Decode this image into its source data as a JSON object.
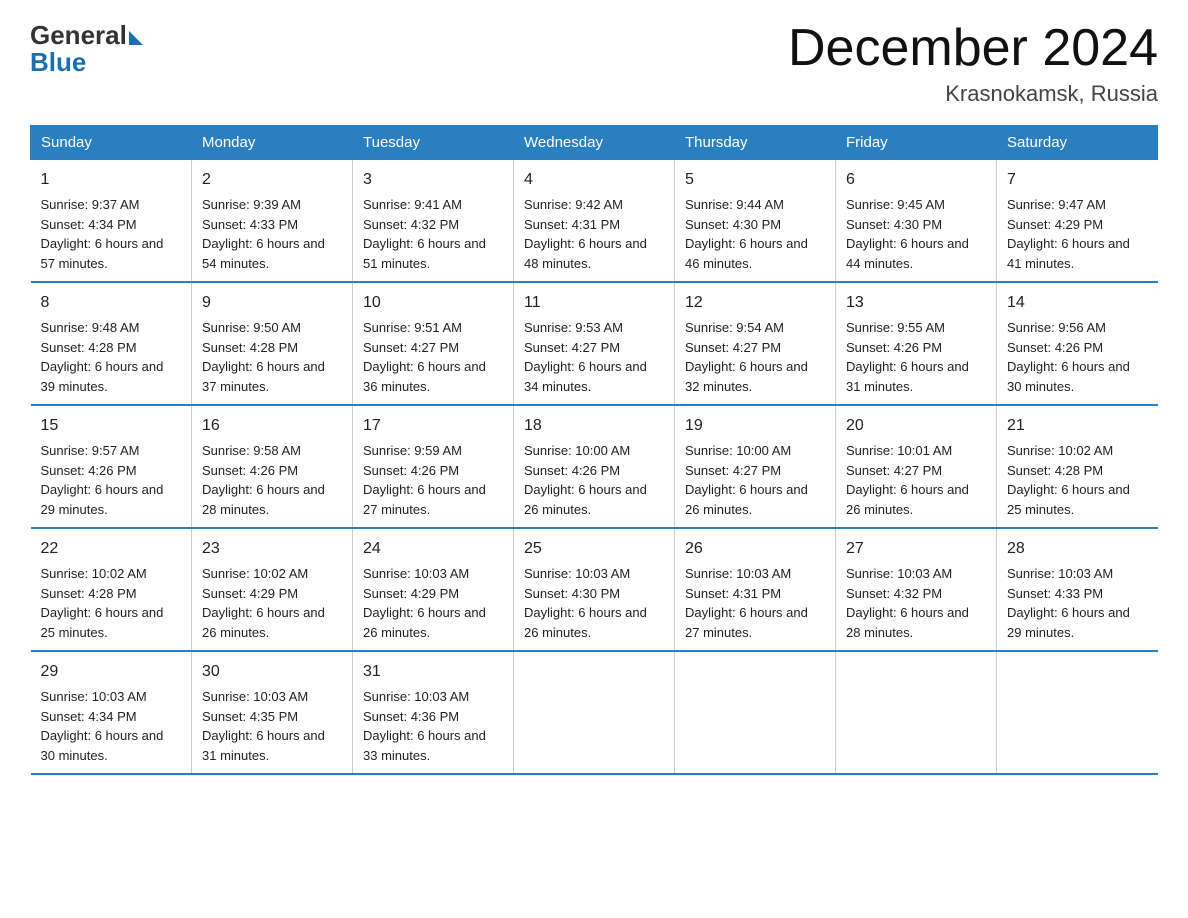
{
  "logo": {
    "general": "General",
    "blue": "Blue"
  },
  "title": "December 2024",
  "location": "Krasnokamsk, Russia",
  "weekdays": [
    "Sunday",
    "Monday",
    "Tuesday",
    "Wednesday",
    "Thursday",
    "Friday",
    "Saturday"
  ],
  "weeks": [
    [
      {
        "day": "1",
        "sunrise": "9:37 AM",
        "sunset": "4:34 PM",
        "daylight": "6 hours and 57 minutes."
      },
      {
        "day": "2",
        "sunrise": "9:39 AM",
        "sunset": "4:33 PM",
        "daylight": "6 hours and 54 minutes."
      },
      {
        "day": "3",
        "sunrise": "9:41 AM",
        "sunset": "4:32 PM",
        "daylight": "6 hours and 51 minutes."
      },
      {
        "day": "4",
        "sunrise": "9:42 AM",
        "sunset": "4:31 PM",
        "daylight": "6 hours and 48 minutes."
      },
      {
        "day": "5",
        "sunrise": "9:44 AM",
        "sunset": "4:30 PM",
        "daylight": "6 hours and 46 minutes."
      },
      {
        "day": "6",
        "sunrise": "9:45 AM",
        "sunset": "4:30 PM",
        "daylight": "6 hours and 44 minutes."
      },
      {
        "day": "7",
        "sunrise": "9:47 AM",
        "sunset": "4:29 PM",
        "daylight": "6 hours and 41 minutes."
      }
    ],
    [
      {
        "day": "8",
        "sunrise": "9:48 AM",
        "sunset": "4:28 PM",
        "daylight": "6 hours and 39 minutes."
      },
      {
        "day": "9",
        "sunrise": "9:50 AM",
        "sunset": "4:28 PM",
        "daylight": "6 hours and 37 minutes."
      },
      {
        "day": "10",
        "sunrise": "9:51 AM",
        "sunset": "4:27 PM",
        "daylight": "6 hours and 36 minutes."
      },
      {
        "day": "11",
        "sunrise": "9:53 AM",
        "sunset": "4:27 PM",
        "daylight": "6 hours and 34 minutes."
      },
      {
        "day": "12",
        "sunrise": "9:54 AM",
        "sunset": "4:27 PM",
        "daylight": "6 hours and 32 minutes."
      },
      {
        "day": "13",
        "sunrise": "9:55 AM",
        "sunset": "4:26 PM",
        "daylight": "6 hours and 31 minutes."
      },
      {
        "day": "14",
        "sunrise": "9:56 AM",
        "sunset": "4:26 PM",
        "daylight": "6 hours and 30 minutes."
      }
    ],
    [
      {
        "day": "15",
        "sunrise": "9:57 AM",
        "sunset": "4:26 PM",
        "daylight": "6 hours and 29 minutes."
      },
      {
        "day": "16",
        "sunrise": "9:58 AM",
        "sunset": "4:26 PM",
        "daylight": "6 hours and 28 minutes."
      },
      {
        "day": "17",
        "sunrise": "9:59 AM",
        "sunset": "4:26 PM",
        "daylight": "6 hours and 27 minutes."
      },
      {
        "day": "18",
        "sunrise": "10:00 AM",
        "sunset": "4:26 PM",
        "daylight": "6 hours and 26 minutes."
      },
      {
        "day": "19",
        "sunrise": "10:00 AM",
        "sunset": "4:27 PM",
        "daylight": "6 hours and 26 minutes."
      },
      {
        "day": "20",
        "sunrise": "10:01 AM",
        "sunset": "4:27 PM",
        "daylight": "6 hours and 26 minutes."
      },
      {
        "day": "21",
        "sunrise": "10:02 AM",
        "sunset": "4:28 PM",
        "daylight": "6 hours and 25 minutes."
      }
    ],
    [
      {
        "day": "22",
        "sunrise": "10:02 AM",
        "sunset": "4:28 PM",
        "daylight": "6 hours and 25 minutes."
      },
      {
        "day": "23",
        "sunrise": "10:02 AM",
        "sunset": "4:29 PM",
        "daylight": "6 hours and 26 minutes."
      },
      {
        "day": "24",
        "sunrise": "10:03 AM",
        "sunset": "4:29 PM",
        "daylight": "6 hours and 26 minutes."
      },
      {
        "day": "25",
        "sunrise": "10:03 AM",
        "sunset": "4:30 PM",
        "daylight": "6 hours and 26 minutes."
      },
      {
        "day": "26",
        "sunrise": "10:03 AM",
        "sunset": "4:31 PM",
        "daylight": "6 hours and 27 minutes."
      },
      {
        "day": "27",
        "sunrise": "10:03 AM",
        "sunset": "4:32 PM",
        "daylight": "6 hours and 28 minutes."
      },
      {
        "day": "28",
        "sunrise": "10:03 AM",
        "sunset": "4:33 PM",
        "daylight": "6 hours and 29 minutes."
      }
    ],
    [
      {
        "day": "29",
        "sunrise": "10:03 AM",
        "sunset": "4:34 PM",
        "daylight": "6 hours and 30 minutes."
      },
      {
        "day": "30",
        "sunrise": "10:03 AM",
        "sunset": "4:35 PM",
        "daylight": "6 hours and 31 minutes."
      },
      {
        "day": "31",
        "sunrise": "10:03 AM",
        "sunset": "4:36 PM",
        "daylight": "6 hours and 33 minutes."
      },
      null,
      null,
      null,
      null
    ]
  ]
}
